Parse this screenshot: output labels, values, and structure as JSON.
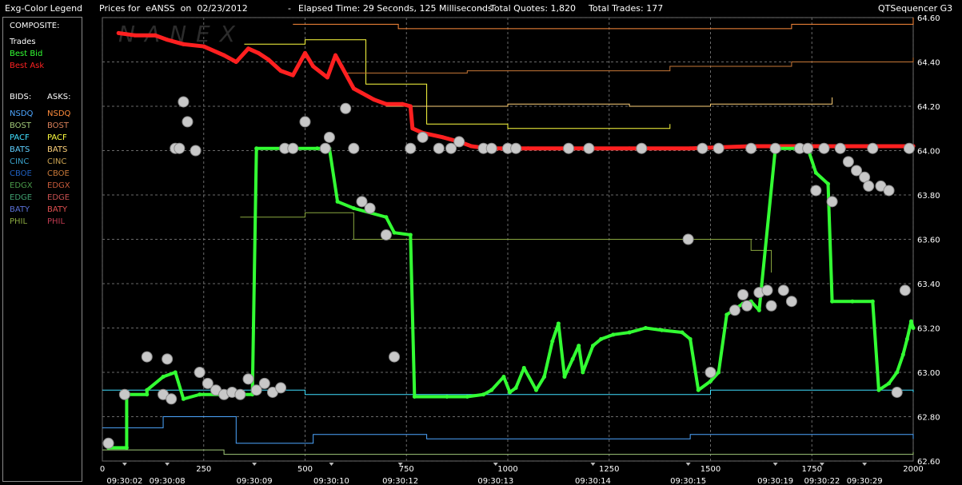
{
  "header": {
    "legend_title": "Exg-Color Legend",
    "prices_for": "Prices for  eANSS  on  02/23/2012",
    "elapsed": "Elapsed Time: 29 Seconds, 125 Milliseconds",
    "total_quotes": "Total Quotes: 1,820",
    "total_trades": "Total Trades: 177",
    "app_name": "QTSequencer G3"
  },
  "legend": {
    "composite_label": "COMPOSITE:",
    "composite": [
      {
        "label": "Trades",
        "color": "#ffffff"
      },
      {
        "label": "Best Bid",
        "color": "#33ff33"
      },
      {
        "label": "Best Ask",
        "color": "#ff2222"
      }
    ],
    "bids_header": "BIDS:",
    "asks_header": "ASKS:",
    "bids": [
      {
        "label": "NSDQ",
        "color": "#4da6ff"
      },
      {
        "label": "BOST",
        "color": "#a0c878"
      },
      {
        "label": "PACF",
        "color": "#40e0ff"
      },
      {
        "label": "BATS",
        "color": "#5fd0ff"
      },
      {
        "label": "CINC",
        "color": "#3aa0c8"
      },
      {
        "label": "CBOE",
        "color": "#1f5fbf"
      },
      {
        "label": "EDGX",
        "color": "#4a9a4a"
      },
      {
        "label": "EDGE",
        "color": "#3f9f6f"
      },
      {
        "label": "BATY",
        "color": "#5a72d8"
      },
      {
        "label": "PHIL",
        "color": "#8aa840"
      }
    ],
    "asks": [
      {
        "label": "NSDQ",
        "color": "#ff8c3c"
      },
      {
        "label": "BOST",
        "color": "#d9805a"
      },
      {
        "label": "PACF",
        "color": "#ffff40"
      },
      {
        "label": "BATS",
        "color": "#ffd27a"
      },
      {
        "label": "CINC",
        "color": "#c8a050"
      },
      {
        "label": "CBOE",
        "color": "#c87838"
      },
      {
        "label": "EDGX",
        "color": "#c85a3a"
      },
      {
        "label": "EDGE",
        "color": "#c85050"
      },
      {
        "label": "BATY",
        "color": "#e05050"
      },
      {
        "label": "PHIL",
        "color": "#c03a50"
      }
    ]
  },
  "chart_data": {
    "type": "line",
    "watermark": "NANEX",
    "grid": true,
    "xlim": [
      0,
      2000
    ],
    "ylim": [
      62.6,
      64.6
    ],
    "x_ticks": [
      0,
      250,
      500,
      750,
      1000,
      1250,
      1500,
      1750,
      2000
    ],
    "y_ticks": [
      "64.60",
      "64.40",
      "64.20",
      "64.00",
      "63.80",
      "63.60",
      "63.40",
      "63.20",
      "63.00",
      "62.80",
      "62.60"
    ],
    "time_labels": [
      {
        "x": 55,
        "label": "09:30:02"
      },
      {
        "x": 160,
        "label": "09:30:08"
      },
      {
        "x": 375,
        "label": "09:30:09"
      },
      {
        "x": 565,
        "label": "09:30:10"
      },
      {
        "x": 735,
        "label": "09:30:12"
      },
      {
        "x": 970,
        "label": "09:30:13"
      },
      {
        "x": 1210,
        "label": "09:30:14"
      },
      {
        "x": 1445,
        "label": "09:30:15"
      },
      {
        "x": 1660,
        "label": "09:30:19"
      },
      {
        "x": 1775,
        "label": "09:30:22"
      },
      {
        "x": 1880,
        "label": "09:30:29"
      }
    ],
    "series": [
      {
        "name": "Best Ask",
        "color": "#ff2020",
        "values": [
          [
            40,
            64.53
          ],
          [
            80,
            64.52
          ],
          [
            130,
            64.52
          ],
          [
            160,
            64.5
          ],
          [
            200,
            64.48
          ],
          [
            250,
            64.47
          ],
          [
            300,
            64.43
          ],
          [
            330,
            64.4
          ],
          [
            360,
            64.46
          ],
          [
            385,
            64.44
          ],
          [
            410,
            64.41
          ],
          [
            440,
            64.36
          ],
          [
            470,
            64.34
          ],
          [
            500,
            64.44
          ],
          [
            520,
            64.38
          ],
          [
            555,
            64.33
          ],
          [
            575,
            64.43
          ],
          [
            590,
            64.38
          ],
          [
            620,
            64.28
          ],
          [
            640,
            64.26
          ],
          [
            670,
            64.23
          ],
          [
            700,
            64.21
          ],
          [
            740,
            64.21
          ],
          [
            760,
            64.2
          ],
          [
            765,
            64.1
          ],
          [
            790,
            64.08
          ],
          [
            840,
            64.06
          ],
          [
            880,
            64.04
          ],
          [
            910,
            64.02
          ],
          [
            950,
            64.01
          ],
          [
            1050,
            64.01
          ],
          [
            1150,
            64.01
          ],
          [
            1300,
            64.01
          ],
          [
            1450,
            64.01
          ],
          [
            1600,
            64.02
          ],
          [
            1700,
            64.02
          ],
          [
            1800,
            64.02
          ],
          [
            1850,
            64.02
          ],
          [
            1950,
            64.02
          ],
          [
            2000,
            64.02
          ]
        ]
      },
      {
        "name": "Best Bid",
        "color": "#33ff33",
        "values": [
          [
            15,
            62.66
          ],
          [
            60,
            62.66
          ],
          [
            60,
            62.9
          ],
          [
            110,
            62.9
          ],
          [
            110,
            62.92
          ],
          [
            150,
            62.98
          ],
          [
            180,
            63.0
          ],
          [
            200,
            62.88
          ],
          [
            240,
            62.9
          ],
          [
            290,
            62.9
          ],
          [
            340,
            62.9
          ],
          [
            370,
            62.9
          ],
          [
            380,
            64.01
          ],
          [
            460,
            64.01
          ],
          [
            530,
            64.01
          ],
          [
            560,
            64.01
          ],
          [
            580,
            63.77
          ],
          [
            620,
            63.74
          ],
          [
            700,
            63.7
          ],
          [
            720,
            63.63
          ],
          [
            760,
            63.62
          ],
          [
            770,
            62.89
          ],
          [
            850,
            62.89
          ],
          [
            900,
            62.89
          ],
          [
            940,
            62.9
          ],
          [
            960,
            62.92
          ],
          [
            990,
            62.98
          ],
          [
            1005,
            62.91
          ],
          [
            1020,
            62.93
          ],
          [
            1040,
            63.02
          ],
          [
            1070,
            62.92
          ],
          [
            1090,
            62.98
          ],
          [
            1110,
            63.14
          ],
          [
            1125,
            63.22
          ],
          [
            1140,
            62.98
          ],
          [
            1160,
            63.06
          ],
          [
            1175,
            63.12
          ],
          [
            1185,
            63.0
          ],
          [
            1210,
            63.12
          ],
          [
            1230,
            63.15
          ],
          [
            1260,
            63.17
          ],
          [
            1300,
            63.18
          ],
          [
            1340,
            63.2
          ],
          [
            1380,
            63.19
          ],
          [
            1430,
            63.18
          ],
          [
            1450,
            63.15
          ],
          [
            1470,
            62.92
          ],
          [
            1500,
            62.96
          ],
          [
            1520,
            63.0
          ],
          [
            1540,
            63.26
          ],
          [
            1580,
            63.31
          ],
          [
            1600,
            63.32
          ],
          [
            1620,
            63.28
          ],
          [
            1660,
            64.01
          ],
          [
            1710,
            64.01
          ],
          [
            1740,
            64.01
          ],
          [
            1760,
            63.9
          ],
          [
            1790,
            63.85
          ],
          [
            1800,
            63.32
          ],
          [
            1850,
            63.32
          ],
          [
            1900,
            63.32
          ],
          [
            1915,
            62.92
          ],
          [
            1940,
            62.95
          ],
          [
            1960,
            63.0
          ],
          [
            1975,
            63.08
          ],
          [
            1985,
            63.15
          ],
          [
            1995,
            63.23
          ],
          [
            2000,
            63.2
          ]
        ]
      }
    ],
    "trades": [
      [
        15,
        62.68
      ],
      [
        55,
        62.9
      ],
      [
        110,
        63.07
      ],
      [
        150,
        62.9
      ],
      [
        160,
        63.06
      ],
      [
        170,
        62.88
      ],
      [
        180,
        64.01
      ],
      [
        190,
        64.01
      ],
      [
        200,
        64.22
      ],
      [
        210,
        64.13
      ],
      [
        230,
        64.0
      ],
      [
        240,
        63.0
      ],
      [
        260,
        62.95
      ],
      [
        280,
        62.92
      ],
      [
        300,
        62.9
      ],
      [
        320,
        62.91
      ],
      [
        340,
        62.9
      ],
      [
        360,
        62.97
      ],
      [
        380,
        62.92
      ],
      [
        400,
        62.95
      ],
      [
        420,
        62.91
      ],
      [
        440,
        62.93
      ],
      [
        450,
        64.01
      ],
      [
        470,
        64.01
      ],
      [
        500,
        64.13
      ],
      [
        550,
        64.01
      ],
      [
        560,
        64.06
      ],
      [
        600,
        64.19
      ],
      [
        620,
        64.01
      ],
      [
        640,
        63.77
      ],
      [
        660,
        63.74
      ],
      [
        700,
        63.62
      ],
      [
        720,
        63.07
      ],
      [
        760,
        64.01
      ],
      [
        790,
        64.06
      ],
      [
        830,
        64.01
      ],
      [
        860,
        64.01
      ],
      [
        880,
        64.04
      ],
      [
        940,
        64.01
      ],
      [
        960,
        64.01
      ],
      [
        1000,
        64.01
      ],
      [
        1020,
        64.01
      ],
      [
        1150,
        64.01
      ],
      [
        1200,
        64.01
      ],
      [
        1330,
        64.01
      ],
      [
        1445,
        63.6
      ],
      [
        1480,
        64.01
      ],
      [
        1500,
        63.0
      ],
      [
        1520,
        64.01
      ],
      [
        1560,
        63.28
      ],
      [
        1580,
        63.35
      ],
      [
        1590,
        63.3
      ],
      [
        1600,
        64.01
      ],
      [
        1620,
        63.36
      ],
      [
        1640,
        63.37
      ],
      [
        1650,
        63.3
      ],
      [
        1660,
        64.01
      ],
      [
        1680,
        63.37
      ],
      [
        1700,
        63.32
      ],
      [
        1720,
        64.01
      ],
      [
        1740,
        64.01
      ],
      [
        1760,
        63.82
      ],
      [
        1780,
        64.01
      ],
      [
        1800,
        63.77
      ],
      [
        1820,
        64.01
      ],
      [
        1840,
        63.95
      ],
      [
        1860,
        63.91
      ],
      [
        1880,
        63.88
      ],
      [
        1890,
        63.84
      ],
      [
        1900,
        64.01
      ],
      [
        1920,
        63.84
      ],
      [
        1940,
        63.82
      ],
      [
        1960,
        62.91
      ],
      [
        1980,
        63.37
      ],
      [
        1990,
        64.01
      ]
    ],
    "exchange_bid_levels": [
      {
        "color": "#4da6ff",
        "values": [
          [
            0,
            62.75
          ],
          [
            150,
            62.8
          ],
          [
            300,
            62.8
          ],
          [
            330,
            62.68
          ],
          [
            520,
            62.72
          ],
          [
            800,
            62.7
          ],
          [
            1450,
            62.72
          ],
          [
            1700,
            62.72
          ],
          [
            2000,
            62.7
          ]
        ]
      },
      {
        "color": "#40e0ff",
        "values": [
          [
            0,
            62.92
          ],
          [
            500,
            62.9
          ],
          [
            1400,
            62.9
          ],
          [
            1500,
            62.92
          ],
          [
            2000,
            62.91
          ]
        ]
      },
      {
        "color": "#a0c878",
        "values": [
          [
            0,
            62.65
          ],
          [
            300,
            62.63
          ],
          [
            600,
            62.63
          ],
          [
            1000,
            62.63
          ],
          [
            1600,
            62.63
          ],
          [
            2000,
            62.64
          ]
        ]
      },
      {
        "color": "#8aa840",
        "values": [
          [
            340,
            63.7
          ],
          [
            500,
            63.72
          ],
          [
            620,
            63.6
          ],
          [
            700,
            63.6
          ],
          [
            1600,
            63.55
          ],
          [
            1650,
            63.45
          ]
        ]
      }
    ],
    "exchange_ask_levels": [
      {
        "color": "#ff8c3c",
        "values": [
          [
            470,
            64.57
          ],
          [
            700,
            64.57
          ],
          [
            730,
            64.55
          ],
          [
            1460,
            64.55
          ],
          [
            1700,
            64.57
          ],
          [
            2000,
            64.6
          ]
        ]
      },
      {
        "color": "#ffff40",
        "values": [
          [
            350,
            64.48
          ],
          [
            500,
            64.5
          ],
          [
            650,
            64.3
          ],
          [
            800,
            64.12
          ],
          [
            1000,
            64.1
          ],
          [
            1200,
            64.1
          ],
          [
            1400,
            64.12
          ]
        ]
      },
      {
        "color": "#c87838",
        "values": [
          [
            600,
            64.35
          ],
          [
            900,
            64.36
          ],
          [
            1100,
            64.36
          ],
          [
            1400,
            64.38
          ],
          [
            1700,
            64.4
          ],
          [
            2000,
            64.42
          ]
        ]
      },
      {
        "color": "#ffd27a",
        "values": [
          [
            700,
            64.2
          ],
          [
            1000,
            64.21
          ],
          [
            1300,
            64.2
          ],
          [
            1500,
            64.21
          ],
          [
            1800,
            64.24
          ]
        ]
      }
    ]
  }
}
